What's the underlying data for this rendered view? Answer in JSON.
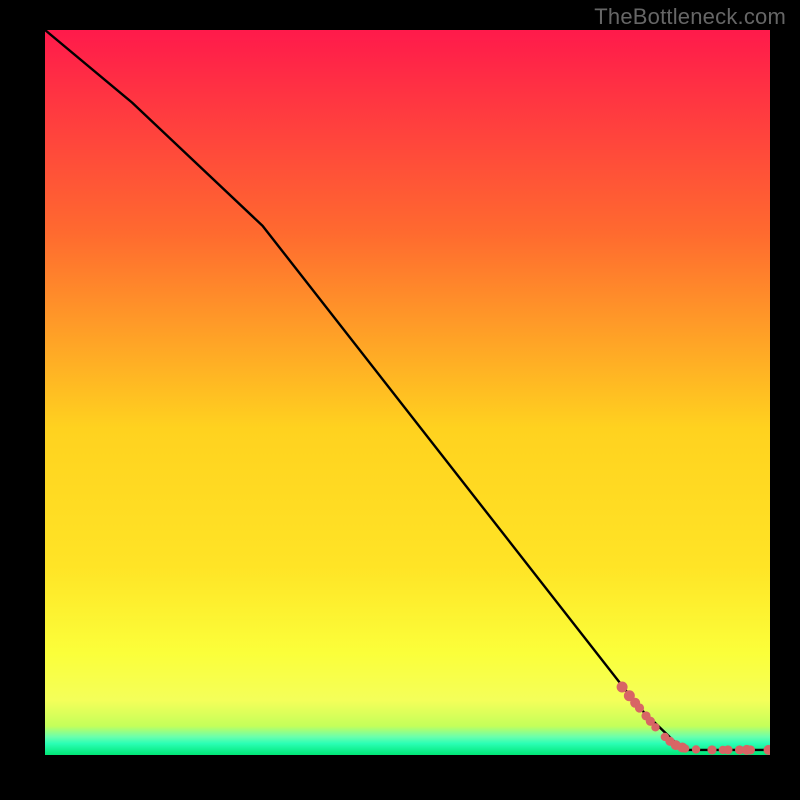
{
  "watermark": "TheBottleneck.com",
  "colors": {
    "page_bg": "#000000",
    "gradient_top": "#ff1a4b",
    "gradient_upper_mid": "#ff7a2a",
    "gradient_mid": "#ffd21f",
    "gradient_lower_mid": "#fbff3a",
    "gradient_lower": "#b7ff4a",
    "gradient_bottom_thin": "#2bffb5",
    "gradient_bottom": "#00e676",
    "line": "#000000",
    "marker": "#d86565"
  },
  "chart_data": {
    "type": "line",
    "title": "",
    "xlabel": "",
    "ylabel": "",
    "xlim": [
      0,
      100
    ],
    "ylim": [
      0,
      100
    ],
    "series": [
      {
        "name": "curve",
        "x": [
          0,
          12,
          30,
          82,
          88,
          100
        ],
        "y": [
          100,
          90,
          73,
          6.5,
          0.7,
          0.7
        ]
      }
    ],
    "markers": {
      "name": "points",
      "x": [
        79.6,
        80.6,
        81.4,
        82.0,
        82.9,
        83.5,
        84.2,
        85.5,
        86.2,
        87.0,
        87.9,
        88.3,
        89.8,
        92.0,
        93.5,
        94.2,
        95.8,
        96.8,
        97.3,
        99.8
      ],
      "y": [
        9.38,
        8.17,
        7.2,
        6.48,
        5.39,
        4.66,
        3.82,
        2.49,
        1.9,
        1.37,
        1.04,
        0.89,
        0.77,
        0.7,
        0.7,
        0.7,
        0.7,
        0.7,
        0.7,
        0.7
      ],
      "r": [
        5.5,
        5.5,
        5.0,
        4.6,
        4.6,
        4.6,
        4.2,
        4.2,
        4.6,
        5.0,
        5.0,
        4.2,
        4.2,
        4.6,
        4.2,
        4.6,
        4.6,
        5.0,
        4.6,
        5.0
      ]
    }
  }
}
